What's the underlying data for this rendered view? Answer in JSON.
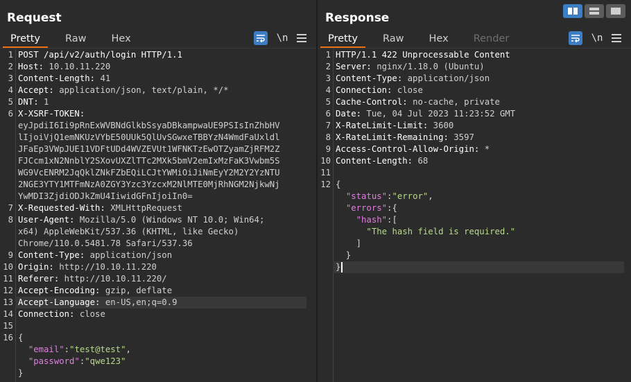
{
  "request": {
    "title": "Request",
    "tabs": [
      "Pretty",
      "Raw",
      "Hex"
    ],
    "active_tab": "Pretty",
    "tools": {
      "wrap_icon": "wrap-lines-icon",
      "newline_label": "\\n",
      "menu_icon": "menu-icon"
    },
    "lines": [
      {
        "n": "1",
        "parts": [
          {
            "c": "hname",
            "t": "POST /api/v2/auth/login HTTP/1.1"
          }
        ]
      },
      {
        "n": "2",
        "parts": [
          {
            "c": "hname",
            "t": "Host: "
          },
          {
            "c": "hval",
            "t": "10.10.11.220"
          }
        ]
      },
      {
        "n": "3",
        "parts": [
          {
            "c": "hname",
            "t": "Content-Length: "
          },
          {
            "c": "hval",
            "t": "41"
          }
        ]
      },
      {
        "n": "4",
        "parts": [
          {
            "c": "hname",
            "t": "Accept: "
          },
          {
            "c": "hval",
            "t": "application/json, text/plain, */*"
          }
        ]
      },
      {
        "n": "5",
        "parts": [
          {
            "c": "hname",
            "t": "DNT: "
          },
          {
            "c": "hval",
            "t": "1"
          }
        ]
      },
      {
        "n": "6",
        "parts": [
          {
            "c": "hname",
            "t": "X-XSRF-TOKEN:"
          }
        ]
      },
      {
        "n": "",
        "parts": [
          {
            "c": "hval",
            "t": "eyJpdiI6Ii9pRnExWVBNdGlkbSsyaDBkampwaUE9PSIsInZhbHV"
          }
        ]
      },
      {
        "n": "",
        "parts": [
          {
            "c": "hval",
            "t": "lIjoiVjQ1emNKUzVYbE50UUk5QlUvSGwxeTBBYzN4WmdFaUxldl"
          }
        ]
      },
      {
        "n": "",
        "parts": [
          {
            "c": "hval",
            "t": "JFaEp3VWpJUE11VDFtUDd4WVZEVUt1WFNKTzEwOTZyamZjRFM2Z"
          }
        ]
      },
      {
        "n": "",
        "parts": [
          {
            "c": "hval",
            "t": "FJCcm1xN2NnblY2SXovUXZlTTc2MXk5bmV2emIxMzFaK3Vwbm5S"
          }
        ]
      },
      {
        "n": "",
        "parts": [
          {
            "c": "hval",
            "t": "WG9VcENRM2JqQklZNkFZbEQiLCJtYWMiOiJiNmEyY2M2Y2YzNTU"
          }
        ]
      },
      {
        "n": "",
        "parts": [
          {
            "c": "hval",
            "t": "2NGE3YTY1MTFmNzA0ZGY3Yzc3YzcxM2NlMTE0MjRhNGM2NjkwNj"
          }
        ]
      },
      {
        "n": "",
        "parts": [
          {
            "c": "hval",
            "t": "YwMDI3ZjdiODJkZmU4IiwidGFnIjoiIn0="
          }
        ]
      },
      {
        "n": "7",
        "parts": [
          {
            "c": "hname",
            "t": "X-Requested-With: "
          },
          {
            "c": "hval",
            "t": "XMLHttpRequest"
          }
        ]
      },
      {
        "n": "8",
        "parts": [
          {
            "c": "hname",
            "t": "User-Agent: "
          },
          {
            "c": "hval",
            "t": "Mozilla/5.0 (Windows NT 10.0; Win64;"
          }
        ]
      },
      {
        "n": "",
        "parts": [
          {
            "c": "hval",
            "t": "x64) AppleWebKit/537.36 (KHTML, like Gecko)"
          }
        ]
      },
      {
        "n": "",
        "parts": [
          {
            "c": "hval",
            "t": "Chrome/110.0.5481.78 Safari/537.36"
          }
        ]
      },
      {
        "n": "9",
        "parts": [
          {
            "c": "hname",
            "t": "Content-Type: "
          },
          {
            "c": "hval",
            "t": "application/json"
          }
        ]
      },
      {
        "n": "10",
        "parts": [
          {
            "c": "hname",
            "t": "Origin: "
          },
          {
            "c": "hval",
            "t": "http://10.10.11.220"
          }
        ]
      },
      {
        "n": "11",
        "parts": [
          {
            "c": "hname",
            "t": "Referer: "
          },
          {
            "c": "hval",
            "t": "http://10.10.11.220/"
          }
        ]
      },
      {
        "n": "12",
        "parts": [
          {
            "c": "hname",
            "t": "Accept-Encoding: "
          },
          {
            "c": "hval",
            "t": "gzip, deflate"
          }
        ]
      },
      {
        "n": "13",
        "cur": true,
        "parts": [
          {
            "c": "hname",
            "t": "Accept-Language: "
          },
          {
            "c": "hval",
            "t": "en-US,en;q=0.9"
          }
        ]
      },
      {
        "n": "14",
        "parts": [
          {
            "c": "hname",
            "t": "Connection: "
          },
          {
            "c": "hval",
            "t": "close"
          }
        ]
      },
      {
        "n": "15",
        "parts": []
      },
      {
        "n": "16",
        "parts": [
          {
            "c": "jpunc",
            "t": "{"
          }
        ]
      },
      {
        "n": "",
        "parts": [
          {
            "c": "jpunc",
            "t": "  "
          },
          {
            "c": "jkey",
            "t": "\"email\""
          },
          {
            "c": "jpunc",
            "t": ":"
          },
          {
            "c": "jstr",
            "t": "\"test@test\""
          },
          {
            "c": "jpunc",
            "t": ","
          }
        ]
      },
      {
        "n": "",
        "parts": [
          {
            "c": "jpunc",
            "t": "  "
          },
          {
            "c": "jkey",
            "t": "\"password\""
          },
          {
            "c": "jpunc",
            "t": ":"
          },
          {
            "c": "jstr",
            "t": "\"qwe123\""
          }
        ]
      },
      {
        "n": "",
        "parts": [
          {
            "c": "jpunc",
            "t": "}"
          }
        ]
      }
    ]
  },
  "response": {
    "title": "Response",
    "tabs": [
      "Pretty",
      "Raw",
      "Hex",
      "Render"
    ],
    "active_tab": "Pretty",
    "disabled_tabs": [
      "Render"
    ],
    "tools": {
      "wrap_icon": "wrap-lines-icon",
      "newline_label": "\\n",
      "menu_icon": "menu-icon"
    },
    "lines": [
      {
        "n": "1",
        "parts": [
          {
            "c": "hname",
            "t": "HTTP/1.1 422 Unprocessable Content"
          }
        ]
      },
      {
        "n": "2",
        "parts": [
          {
            "c": "hname",
            "t": "Server: "
          },
          {
            "c": "hval",
            "t": "nginx/1.18.0 (Ubuntu)"
          }
        ]
      },
      {
        "n": "3",
        "parts": [
          {
            "c": "hname",
            "t": "Content-Type: "
          },
          {
            "c": "hval",
            "t": "application/json"
          }
        ]
      },
      {
        "n": "4",
        "parts": [
          {
            "c": "hname",
            "t": "Connection: "
          },
          {
            "c": "hval",
            "t": "close"
          }
        ]
      },
      {
        "n": "5",
        "parts": [
          {
            "c": "hname",
            "t": "Cache-Control: "
          },
          {
            "c": "hval",
            "t": "no-cache, private"
          }
        ]
      },
      {
        "n": "6",
        "parts": [
          {
            "c": "hname",
            "t": "Date: "
          },
          {
            "c": "hval",
            "t": "Tue, 04 Jul 2023 11:23:52 GMT"
          }
        ]
      },
      {
        "n": "7",
        "parts": [
          {
            "c": "hname",
            "t": "X-RateLimit-Limit: "
          },
          {
            "c": "hval",
            "t": "3600"
          }
        ]
      },
      {
        "n": "8",
        "parts": [
          {
            "c": "hname",
            "t": "X-RateLimit-Remaining: "
          },
          {
            "c": "hval",
            "t": "3597"
          }
        ]
      },
      {
        "n": "9",
        "parts": [
          {
            "c": "hname",
            "t": "Access-Control-Allow-Origin: "
          },
          {
            "c": "hval",
            "t": "*"
          }
        ]
      },
      {
        "n": "10",
        "parts": [
          {
            "c": "hname",
            "t": "Content-Length: "
          },
          {
            "c": "hval",
            "t": "68"
          }
        ]
      },
      {
        "n": "11",
        "parts": []
      },
      {
        "n": "12",
        "parts": [
          {
            "c": "jpunc",
            "t": "{"
          }
        ]
      },
      {
        "n": "",
        "parts": [
          {
            "c": "jpunc",
            "t": "  "
          },
          {
            "c": "jkey",
            "t": "\"status\""
          },
          {
            "c": "jpunc",
            "t": ":"
          },
          {
            "c": "jstr",
            "t": "\"error\""
          },
          {
            "c": "jpunc",
            "t": ","
          }
        ]
      },
      {
        "n": "",
        "parts": [
          {
            "c": "jpunc",
            "t": "  "
          },
          {
            "c": "jkey",
            "t": "\"errors\""
          },
          {
            "c": "jpunc",
            "t": ":{"
          }
        ]
      },
      {
        "n": "",
        "parts": [
          {
            "c": "jpunc",
            "t": "    "
          },
          {
            "c": "jkey",
            "t": "\"hash\""
          },
          {
            "c": "jpunc",
            "t": ":["
          }
        ]
      },
      {
        "n": "",
        "parts": [
          {
            "c": "jpunc",
            "t": "      "
          },
          {
            "c": "jstr",
            "t": "\"The hash field is required.\""
          }
        ]
      },
      {
        "n": "",
        "parts": [
          {
            "c": "jpunc",
            "t": "    ]"
          }
        ]
      },
      {
        "n": "",
        "parts": [
          {
            "c": "jpunc",
            "t": "  }"
          }
        ]
      },
      {
        "n": "",
        "cur": true,
        "caret": true,
        "parts": [
          {
            "c": "jpunc",
            "t": "}"
          }
        ]
      }
    ]
  },
  "layout_switch": {
    "icons": [
      "split-columns-icon",
      "split-rows-icon",
      "single-pane-icon"
    ],
    "active": 0
  },
  "colors": {
    "accent": "#e8701a",
    "toggle_active": "#3d7dc4",
    "header_name": "#ffffff",
    "json_key": "#e07ee0",
    "json_string": "#b9d98b"
  }
}
